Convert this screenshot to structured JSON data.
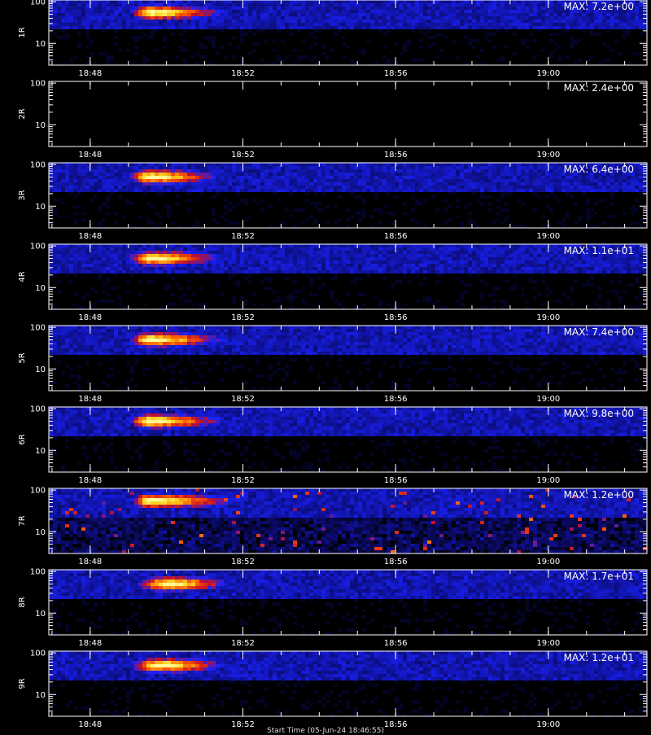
{
  "chart_data": {
    "type": "heatmap",
    "title": "",
    "xlabel": "Start Time (05-Jun-24 18:46:55)",
    "x_ticks": [
      "18:48",
      "18:52",
      "18:56",
      "19:00"
    ],
    "x_range": [
      "18:46:55",
      "19:02:35"
    ],
    "y_scale": "log",
    "ylim": [
      3,
      110
    ],
    "y_ticks": [
      "10",
      "100"
    ],
    "colormap": [
      "#000000",
      "#0b0b6e",
      "#1a22ff",
      "#c0102a",
      "#ff5a00",
      "#ffd020",
      "#ffff99"
    ],
    "panels": [
      {
        "label": "1R",
        "max_label": "MAX: 7.2e+00",
        "max": 7.2,
        "burst_start": "18:48:55",
        "burst_end": "18:52:00",
        "peak_time": "18:49:30",
        "peak_y": 60
      },
      {
        "label": "2R",
        "max_label": "MAX: 2.4e+00",
        "max": 2.4,
        "burst_start": "",
        "burst_end": "",
        "peak_time": "",
        "peak_y": 0
      },
      {
        "label": "3R",
        "max_label": "MAX: 6.4e+00",
        "max": 6.4,
        "burst_start": "18:48:50",
        "burst_end": "18:51:50",
        "peak_time": "18:49:30",
        "peak_y": 55
      },
      {
        "label": "4R",
        "max_label": "MAX: 1.1e+01",
        "max": 11,
        "burst_start": "18:48:50",
        "burst_end": "18:52:00",
        "peak_time": "18:49:30",
        "peak_y": 55
      },
      {
        "label": "5R",
        "max_label": "MAX: 7.4e+00",
        "max": 7.4,
        "burst_start": "18:48:50",
        "burst_end": "18:52:00",
        "peak_time": "18:49:30",
        "peak_y": 55
      },
      {
        "label": "6R",
        "max_label": "MAX: 9.8e+00",
        "max": 9.8,
        "burst_start": "18:48:50",
        "burst_end": "18:52:00",
        "peak_time": "18:49:30",
        "peak_y": 55
      },
      {
        "label": "7R",
        "max_label": "MAX: 1.2e+00",
        "max": 1.2,
        "burst_start": "18:48:55",
        "burst_end": "18:52:30",
        "peak_time": "18:49:30",
        "peak_y": 60
      },
      {
        "label": "8R",
        "max_label": "MAX: 1.7e+01",
        "max": 17,
        "burst_start": "18:48:55",
        "burst_end": "18:52:00",
        "peak_time": "18:50:00",
        "peak_y": 55
      },
      {
        "label": "9R",
        "max_label": "MAX: 1.2e+01",
        "max": 12,
        "burst_start": "18:48:50",
        "burst_end": "18:52:00",
        "peak_time": "18:49:45",
        "peak_y": 55
      }
    ]
  }
}
